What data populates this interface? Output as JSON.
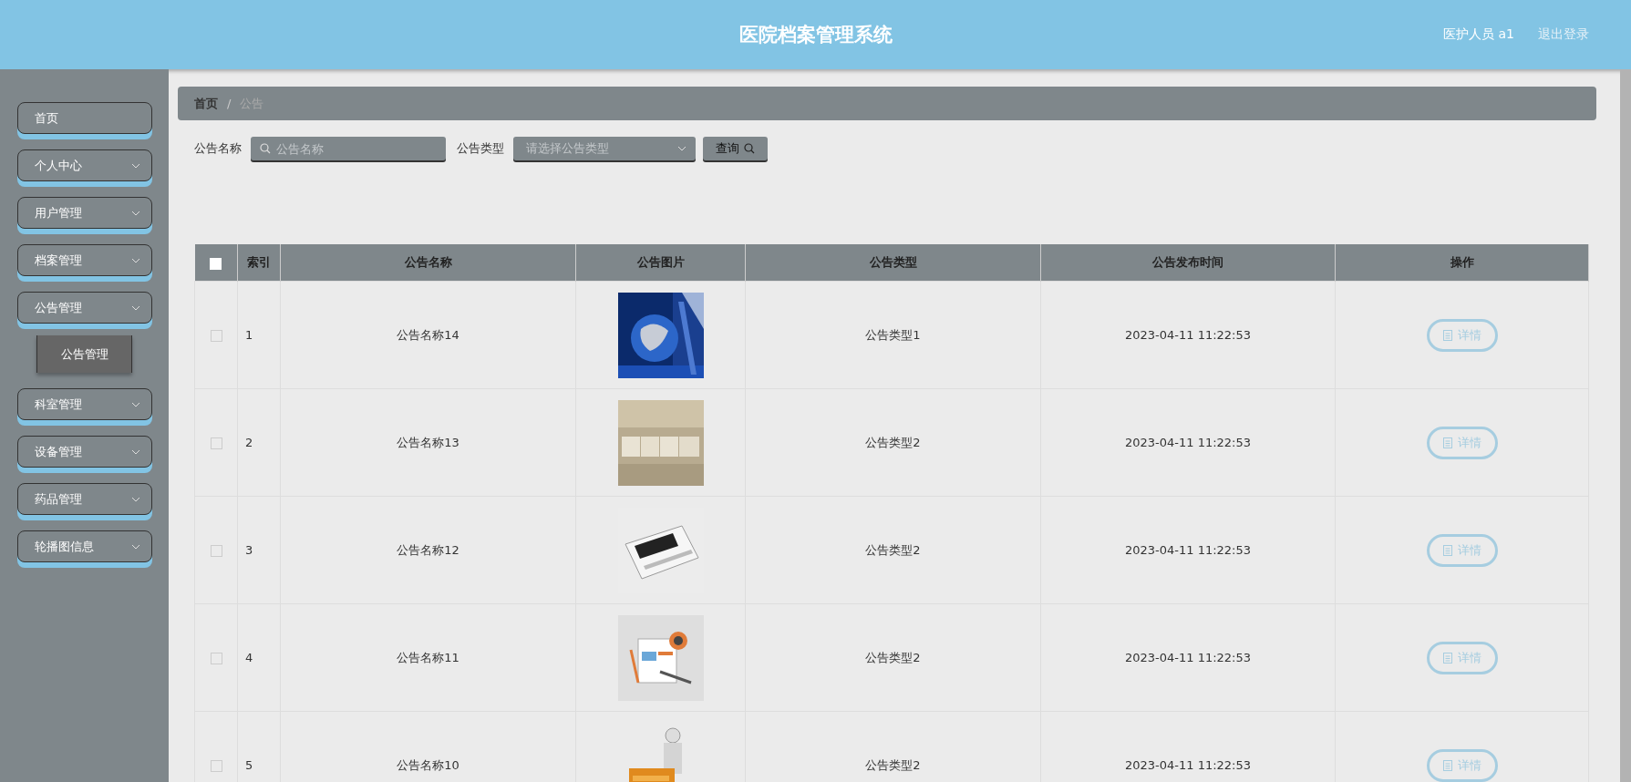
{
  "header": {
    "title": "医院档案管理系统",
    "user": "医护人员 a1",
    "logout": "退出登录"
  },
  "sidebar": {
    "items": [
      {
        "label": "首页",
        "kind": "link"
      },
      {
        "label": "个人中心",
        "kind": "menu"
      },
      {
        "label": "用户管理",
        "kind": "menu"
      },
      {
        "label": "档案管理",
        "kind": "menu"
      },
      {
        "label": "公告管理",
        "kind": "menu",
        "children": [
          {
            "label": "公告管理"
          }
        ]
      },
      {
        "label": "科室管理",
        "kind": "menu"
      },
      {
        "label": "设备管理",
        "kind": "menu"
      },
      {
        "label": "药品管理",
        "kind": "menu"
      },
      {
        "label": "轮播图信息",
        "kind": "menu"
      }
    ]
  },
  "breadcrumb": {
    "items": [
      "首页",
      "公告"
    ],
    "separator": "/"
  },
  "search": {
    "name_label": "公告名称",
    "name_placeholder": "公告名称",
    "type_label": "公告类型",
    "type_placeholder": "请选择公告类型",
    "button": "查询"
  },
  "table": {
    "header_checked": false,
    "columns": [
      "索引",
      "公告名称",
      "公告图片",
      "公告类型",
      "公告发布时间",
      "操作"
    ],
    "rows": [
      {
        "checked": false,
        "index": "1",
        "name": "公告名称14",
        "type": "公告类型1",
        "time": "2023-04-11 11:22:53",
        "action": "详情"
      },
      {
        "checked": false,
        "index": "2",
        "name": "公告名称13",
        "type": "公告类型2",
        "time": "2023-04-11 11:22:53",
        "action": "详情"
      },
      {
        "checked": false,
        "index": "3",
        "name": "公告名称12",
        "type": "公告类型2",
        "time": "2023-04-11 11:22:53",
        "action": "详情"
      },
      {
        "checked": false,
        "index": "4",
        "name": "公告名称11",
        "type": "公告类型2",
        "time": "2023-04-11 11:22:53",
        "action": "详情"
      },
      {
        "checked": false,
        "index": "5",
        "name": "公告名称10",
        "type": "公告类型2",
        "time": "2023-04-11 11:22:53",
        "action": "详情"
      }
    ]
  }
}
